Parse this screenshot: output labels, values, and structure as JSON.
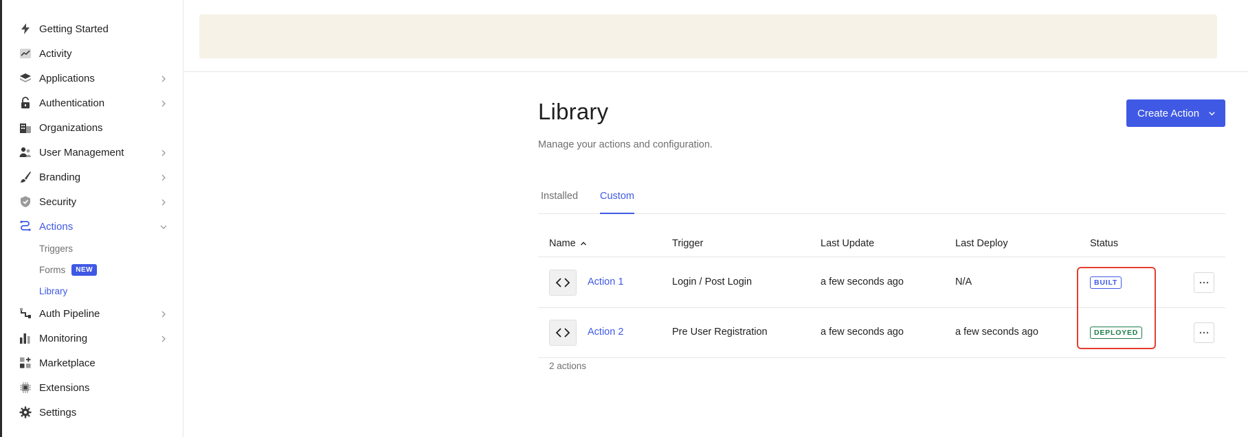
{
  "sidebar": {
    "items": [
      {
        "label": "Getting Started",
        "icon": "bolt-icon"
      },
      {
        "label": "Activity",
        "icon": "activity-chart-icon"
      },
      {
        "label": "Applications",
        "icon": "layers-icon",
        "chevron": true
      },
      {
        "label": "Authentication",
        "icon": "lock-open-icon",
        "chevron": true
      },
      {
        "label": "Organizations",
        "icon": "building-icon"
      },
      {
        "label": "User Management",
        "icon": "users-icon",
        "chevron": true
      },
      {
        "label": "Branding",
        "icon": "brush-icon",
        "chevron": true
      },
      {
        "label": "Security",
        "icon": "shield-check-icon",
        "chevron": true
      },
      {
        "label": "Actions",
        "icon": "actions-flow-icon",
        "chevron": true,
        "active": true
      },
      {
        "label": "Auth Pipeline",
        "icon": "pipeline-icon",
        "chevron": true
      },
      {
        "label": "Monitoring",
        "icon": "bar-chart-icon",
        "chevron": true
      },
      {
        "label": "Marketplace",
        "icon": "grid-plus-icon"
      },
      {
        "label": "Extensions",
        "icon": "chip-icon"
      },
      {
        "label": "Settings",
        "icon": "gear-icon"
      }
    ],
    "actions_sub": [
      {
        "label": "Triggers"
      },
      {
        "label": "Forms",
        "badge": "NEW"
      },
      {
        "label": "Library",
        "active": true
      }
    ]
  },
  "page": {
    "title": "Library",
    "subtitle": "Manage your actions and configuration.",
    "create_button": "Create Action"
  },
  "tabs": [
    {
      "label": "Installed"
    },
    {
      "label": "Custom",
      "active": true
    }
  ],
  "table": {
    "headers": [
      "Name",
      "Trigger",
      "Last Update",
      "Last Deploy",
      "Status"
    ],
    "rows": [
      {
        "name": "Action 1",
        "trigger": "Login / Post Login",
        "last_update": "a few seconds ago",
        "last_deploy": "N/A",
        "status": "BUILT"
      },
      {
        "name": "Action 2",
        "trigger": "Pre User Registration",
        "last_update": "a few seconds ago",
        "last_deploy": "a few seconds ago",
        "status": "DEPLOYED"
      }
    ],
    "footer": "2 actions"
  },
  "colors": {
    "accent": "#3f59e4",
    "deployed": "#1c7c4a",
    "banner": "#f6f2e7",
    "highlight": "#e53c2c"
  }
}
